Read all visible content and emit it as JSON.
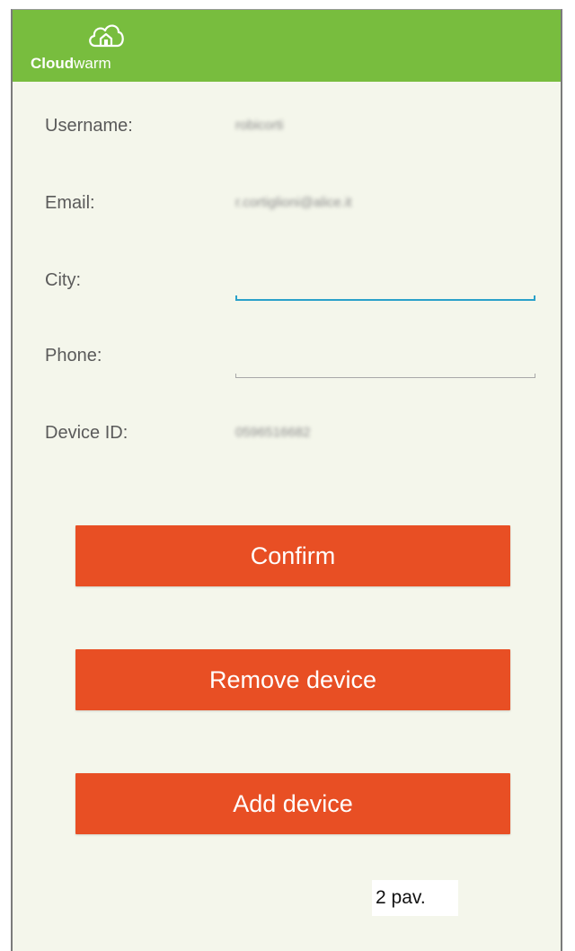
{
  "app": {
    "logo_bold": "Cloud",
    "logo_light": "warm"
  },
  "profile": {
    "username_label": "Username:",
    "username_value": "robicorti",
    "email_label": "Email:",
    "email_value": "r.cortiglioni@alice.it",
    "city_label": "City:",
    "city_value": "",
    "phone_label": "Phone:",
    "phone_value": "",
    "device_id_label": "Device ID:",
    "device_id_value": "0596516682"
  },
  "actions": {
    "confirm_label": "Confirm",
    "remove_label": "Remove device",
    "add_label": "Add device"
  },
  "footer": {
    "page_label": "2 pav."
  },
  "colors": {
    "appbar": "#78bd3e",
    "background": "#f4f6eb",
    "button": "#e84f24",
    "focus_underline": "#2aa1c9"
  },
  "icons": {
    "logo": "cloud-house-icon"
  }
}
